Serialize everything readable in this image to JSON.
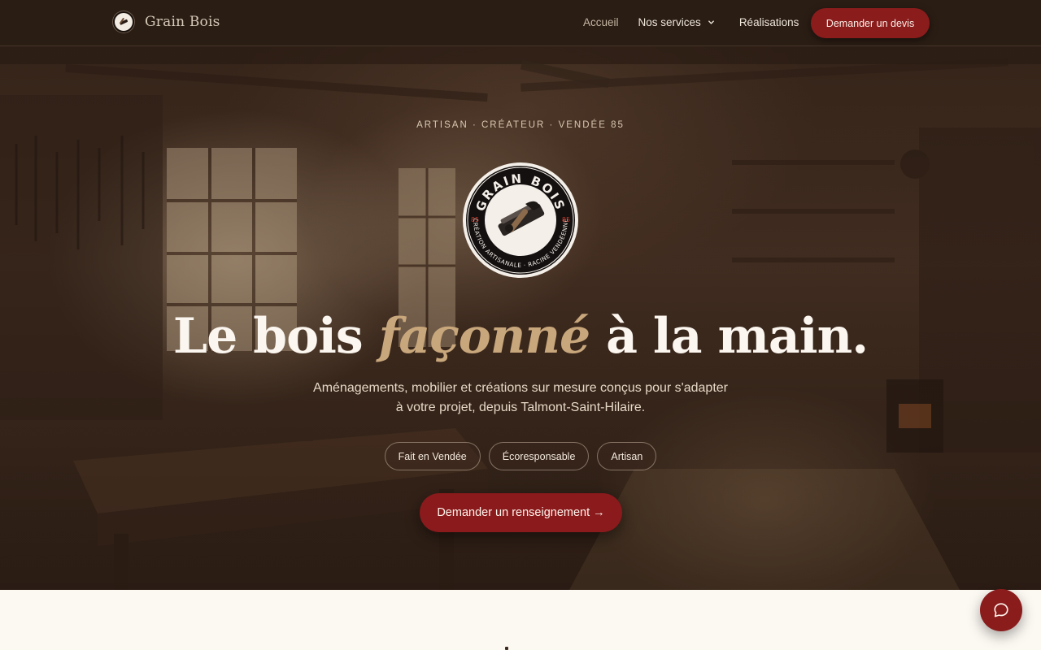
{
  "header": {
    "brand_name": "Grain Bois",
    "brand_icon": "grain-bois-logo-icon",
    "nav": [
      {
        "label": "Accueil",
        "active": true
      },
      {
        "label": "Nos services",
        "has_dropdown": true
      },
      {
        "label": "Réalisations"
      }
    ],
    "cta_label": "Demander un devis"
  },
  "hero": {
    "kicker": "ARTISAN · CRÉATEUR · VENDÉE 85",
    "badge": {
      "top_text": "GRAIN BOIS",
      "bottom_text": "CRÉATION ARTISANALE · RACINE VENDÉENNE",
      "left_number": "85",
      "right_number": "85",
      "icon": "hand-plane-icon"
    },
    "headline_before": "Le bois ",
    "headline_accent": "façonné",
    "headline_after": " à la main.",
    "subtitle_line1": "Aménagements, mobilier et créations sur mesure conçus pour s'adapter",
    "subtitle_line2": "à votre projet, depuis Talmont-Saint-Hilaire.",
    "tags": [
      "Fait en Vendée",
      "Écoresponsable",
      "Artisan"
    ],
    "cta_label": "Demander un renseignement →"
  },
  "chat": {
    "icon": "chat-bubble-icon"
  },
  "colors": {
    "header_bg": "#2a1d14",
    "brand_red": "#8a1c1c",
    "accent_gold": "#c9a77c",
    "page_bg": "#fcf8f2"
  }
}
